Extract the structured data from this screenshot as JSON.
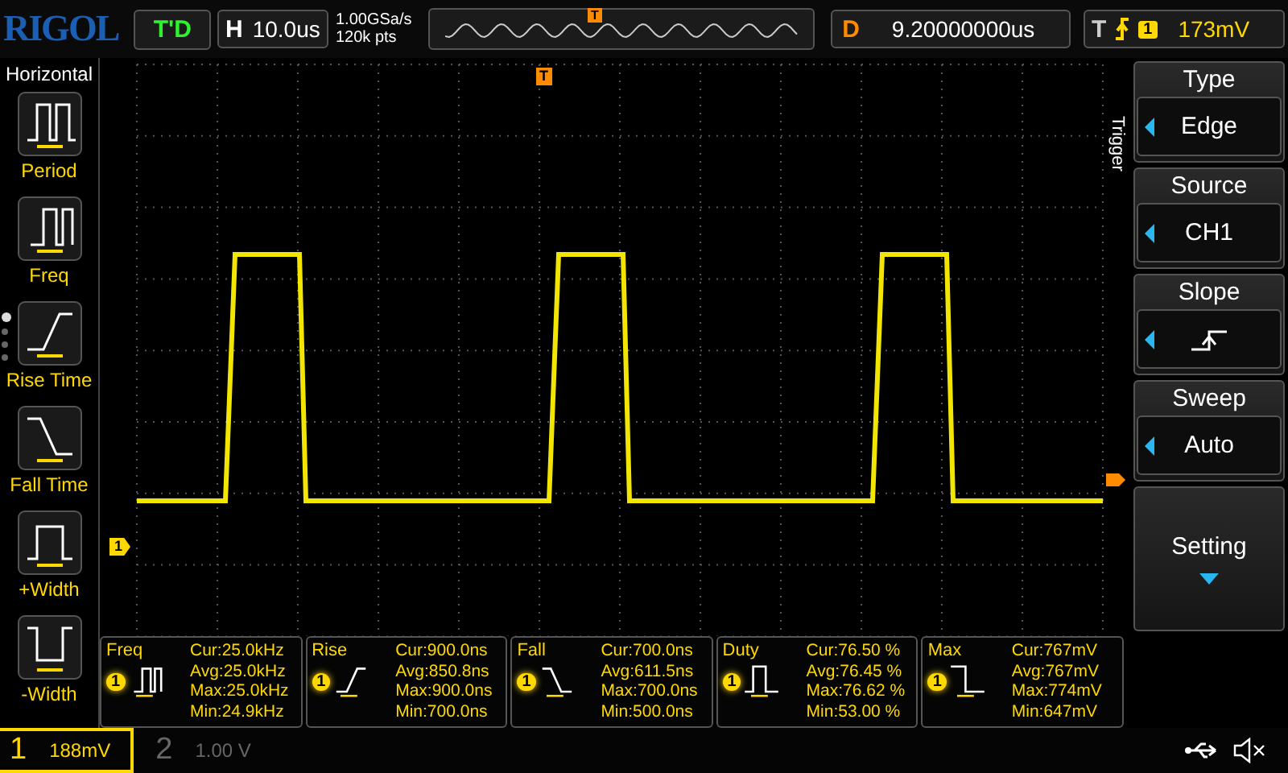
{
  "brand": "RIGOL",
  "run_state": "T'D",
  "horizontal": {
    "label": "H",
    "timebase": "10.0us",
    "sample_rate": "1.00GSa/s",
    "memory_depth": "120k pts",
    "overview_marker": "T"
  },
  "delay": {
    "label": "D",
    "value": "9.20000000us"
  },
  "trigger": {
    "label": "T",
    "channel": "1",
    "level": "173mV"
  },
  "left_menu": {
    "title": "Horizontal",
    "items": [
      {
        "label": "Period",
        "kind": "period"
      },
      {
        "label": "Freq",
        "kind": "freq"
      },
      {
        "label": "Rise Time",
        "kind": "rise"
      },
      {
        "label": "Fall Time",
        "kind": "fall"
      },
      {
        "label": "+Width",
        "kind": "pwidth"
      },
      {
        "label": "-Width",
        "kind": "nwidth"
      }
    ],
    "pages": [
      {
        "selected": true
      },
      {
        "selected": false
      },
      {
        "selected": false
      },
      {
        "selected": false
      }
    ]
  },
  "plot": {
    "trigger_position_marker": "T",
    "channel_marker": "1",
    "side_label": "Trigger"
  },
  "right_menu": [
    {
      "label": "Type",
      "kind": "value",
      "value": "Edge"
    },
    {
      "label": "Source",
      "kind": "value",
      "value": "CH1"
    },
    {
      "label": "Slope",
      "kind": "slope"
    },
    {
      "label": "Sweep",
      "kind": "value",
      "value": "Auto"
    },
    {
      "label": "Setting",
      "kind": "submenu"
    }
  ],
  "measurements": [
    {
      "name": "Freq",
      "channel": "1",
      "kind": "freq",
      "lines": [
        "Cur:25.0kHz",
        "Avg:25.0kHz",
        "Max:25.0kHz",
        "Min:24.9kHz"
      ]
    },
    {
      "name": "Rise",
      "channel": "1",
      "kind": "rise",
      "lines": [
        "Cur:900.0ns",
        "Avg:850.8ns",
        "Max:900.0ns",
        "Min:700.0ns"
      ]
    },
    {
      "name": "Fall",
      "channel": "1",
      "kind": "fall",
      "lines": [
        "Cur:700.0ns",
        "Avg:611.5ns",
        "Max:700.0ns",
        "Min:500.0ns"
      ]
    },
    {
      "name": "Duty",
      "channel": "1",
      "kind": "duty",
      "lines": [
        "Cur:76.50 %",
        "Avg:76.45 %",
        "Max:76.62 %",
        "Min:53.00 %"
      ]
    },
    {
      "name": "Max",
      "channel": "1",
      "kind": "max",
      "lines": [
        "Cur:767mV",
        "Avg:767mV",
        "Max:774mV",
        "Min:647mV"
      ]
    }
  ],
  "channels": [
    {
      "number": "1",
      "scale": "188mV",
      "active": true
    },
    {
      "number": "2",
      "scale": "1.00 V",
      "active": false
    }
  ]
}
